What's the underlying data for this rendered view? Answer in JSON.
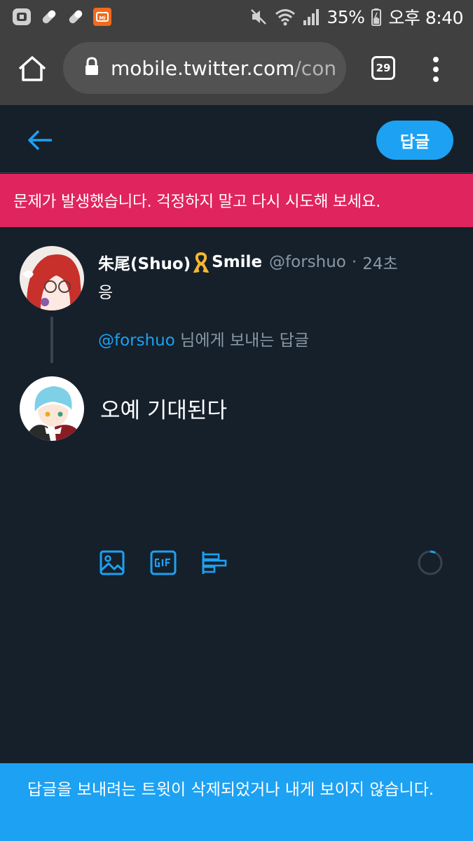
{
  "status_bar": {
    "battery": "35%",
    "time": "오후 8:40"
  },
  "browser": {
    "url_main": "mobile.twitter.com",
    "url_rest": "/con",
    "tab_count": "29"
  },
  "header": {
    "reply_button_label": "답글"
  },
  "error_banner": {
    "message": "문제가 발생했습니다. 걱정하지 말고 다시 시도해 보세요."
  },
  "tweet": {
    "display_name": "朱尾(Shuo)",
    "display_name_suffix": "Smile",
    "handle": "@forshuo",
    "separator": "·",
    "time": "24초",
    "text": "응"
  },
  "reply_context": {
    "mention": "@forshuo",
    "suffix": " 님에게 보내는 답글"
  },
  "compose": {
    "text": "오예 기대된다"
  },
  "toast": {
    "message": "답글을 보내려는 트윗이 삭제되었거나 내게 보이지 않습니다."
  },
  "colors": {
    "background": "#15202b",
    "accent": "#1da1f2",
    "error": "#e0245e",
    "secondary_text": "#8899a6",
    "browser_chrome": "#404040"
  }
}
